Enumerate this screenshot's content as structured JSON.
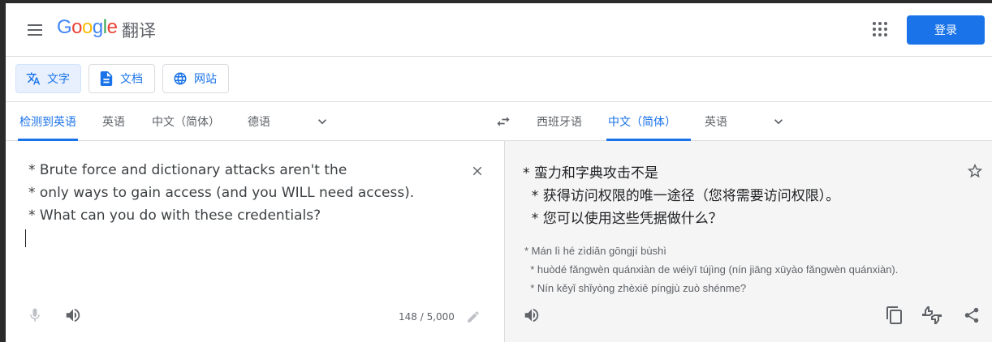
{
  "header": {
    "logo_text": "Google",
    "logo_suffix": "翻译",
    "signin_label": "登录",
    "icons": [
      "menu-icon",
      "apps-grid-icon"
    ]
  },
  "modes": {
    "text_label": "文字",
    "docs_label": "文档",
    "sites_label": "网站",
    "active": "text"
  },
  "source_langs": {
    "detect": "检测到英语",
    "en": "英语",
    "zh": "中文（简体）",
    "de": "德语"
  },
  "target_langs": {
    "es": "西班牙语",
    "zh": "中文（简体）",
    "en": "英语"
  },
  "source": {
    "lines": [
      "* Brute force and dictionary attacks aren't the",
      "* only ways to gain access (and you WILL need access).",
      "* What can you do with these credentials?"
    ],
    "char_count": "148 / 5,000"
  },
  "target": {
    "lines": [
      "* 蛮力和字典攻击不是",
      "  * 获得访问权限的唯一途径（您将需要访问权限）。",
      "  * 您可以使用这些凭据做什么？"
    ],
    "romanization": [
      "* Mán lì hé zìdiǎn gōngjí bùshì",
      "  * huòdé fǎngwèn quánxiàn de wéiyī tújìng (nín jiāng xūyào fǎngwèn quánxiàn).",
      "  * Nín kěyǐ shǐyòng zhèxiē píngjù zuò shénme?"
    ]
  },
  "colors": {
    "accent": "#1a73e8",
    "text": "#3c4043",
    "muted": "#5f6368",
    "target_bg": "#f5f5f5"
  }
}
